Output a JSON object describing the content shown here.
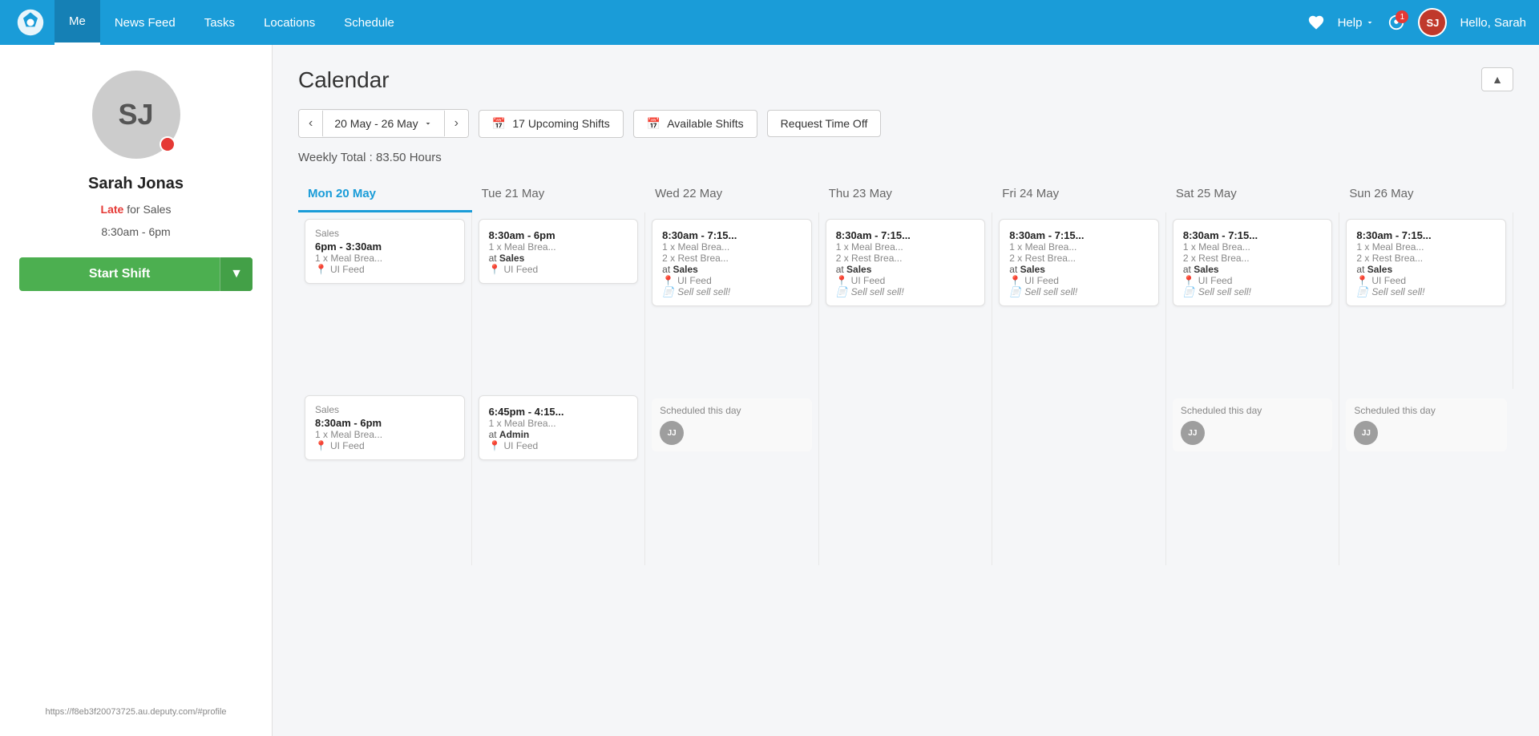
{
  "app": {
    "logo_alt": "Deputy Logo"
  },
  "topnav": {
    "links": [
      {
        "id": "me",
        "label": "Me",
        "active": true
      },
      {
        "id": "news-feed",
        "label": "News Feed",
        "active": false
      },
      {
        "id": "tasks",
        "label": "Tasks",
        "active": false
      },
      {
        "id": "locations",
        "label": "Locations",
        "active": false
      },
      {
        "id": "schedule",
        "label": "Schedule",
        "active": false
      }
    ],
    "help_label": "Help",
    "notification_count": "1",
    "user_initials": "SJ",
    "greeting": "Hello, Sarah"
  },
  "sidebar": {
    "avatar_initials": "SJ",
    "name": "Sarah Jonas",
    "status_prefix": "Late",
    "status_suffix": " for Sales",
    "time": "8:30am - 6pm",
    "start_shift_label": "Start Shift",
    "footer_url": "https://f8eb3f20073725.au.deputy.com/#profile"
  },
  "main": {
    "page_title": "Calendar",
    "week_range": "20 May - 26 May",
    "upcoming_shifts_label": "17 Upcoming Shifts",
    "available_shifts_label": "Available Shifts",
    "request_time_off_label": "Request Time Off",
    "weekly_total_label": "Weekly Total : 83.50 Hours",
    "collapse_icon": "▲",
    "days": [
      {
        "id": "mon",
        "label": "Mon 20 May",
        "today": true
      },
      {
        "id": "tue",
        "label": "Tue 21 May",
        "today": false
      },
      {
        "id": "wed",
        "label": "Wed 22 May",
        "today": false
      },
      {
        "id": "thu",
        "label": "Thu 23 May",
        "today": false
      },
      {
        "id": "fri",
        "label": "Fri 24 May",
        "today": false
      },
      {
        "id": "sat",
        "label": "Sat 25 May",
        "today": false
      },
      {
        "id": "sun",
        "label": "Sun 26 May",
        "today": false
      }
    ],
    "row1_shifts": [
      {
        "day": "mon",
        "role": "Sales",
        "time": "6pm - 3:30am",
        "break": "1 x Meal Brea...",
        "at": null,
        "location": "UI Feed",
        "notes": null
      },
      {
        "day": "tue",
        "role": null,
        "time": "8:30am - 6pm",
        "break": "1 x Meal Brea...",
        "at": "Sales",
        "location": "UI Feed",
        "notes": null
      },
      {
        "day": "wed",
        "role": null,
        "time": "8:30am - 7:15...",
        "break1": "1 x Meal Brea...",
        "break2": "2 x Rest Brea...",
        "at": "Sales",
        "location": "UI Feed",
        "notes": "Sell sell sell!"
      },
      {
        "day": "thu",
        "role": null,
        "time": "8:30am - 7:15...",
        "break1": "1 x Meal Brea...",
        "break2": "2 x Rest Brea...",
        "at": "Sales",
        "location": "UI Feed",
        "notes": "Sell sell sell!"
      },
      {
        "day": "fri",
        "role": null,
        "time": "8:30am - 7:15...",
        "break1": "1 x Meal Brea...",
        "break2": "2 x Rest Brea...",
        "at": "Sales",
        "location": "UI Feed",
        "notes": "Sell sell sell!"
      },
      {
        "day": "sat",
        "role": null,
        "time": "8:30am - 7:15...",
        "break1": "1 x Meal Brea...",
        "break2": "2 x Rest Brea...",
        "at": "Sales",
        "location": "UI Feed",
        "notes": "Sell sell sell!"
      },
      {
        "day": "sun",
        "role": null,
        "time": "8:30am - 7:15...",
        "break1": "1 x Meal Brea...",
        "break2": "2 x Rest Brea...",
        "at": "Sales",
        "location": "UI Feed",
        "notes": "Sell sell sell!"
      }
    ],
    "row2_shifts": [
      {
        "day": "mon",
        "role": "Sales",
        "time": "8:30am - 6pm",
        "break": "1 x Meal Brea...",
        "at": null,
        "location": "UI Feed",
        "notes": null,
        "scheduled": null
      },
      {
        "day": "tue",
        "role": null,
        "time": "6:45pm - 4:15...",
        "break": "1 x Meal Brea...",
        "at": "Admin",
        "location": "UI Feed",
        "notes": null,
        "scheduled": null
      },
      {
        "day": "wed",
        "role": null,
        "time": null,
        "break": null,
        "at": null,
        "location": null,
        "notes": null,
        "scheduled": "JJ"
      },
      {
        "day": "thu",
        "role": null,
        "time": null,
        "break": null,
        "at": null,
        "location": null,
        "notes": null,
        "scheduled": null
      },
      {
        "day": "fri",
        "role": null,
        "time": null,
        "break": null,
        "at": null,
        "location": null,
        "notes": null,
        "scheduled": null
      },
      {
        "day": "sat",
        "role": null,
        "time": null,
        "break": null,
        "at": null,
        "location": null,
        "notes": null,
        "scheduled": "JJ"
      },
      {
        "day": "sun",
        "role": null,
        "time": null,
        "break": null,
        "at": null,
        "location": null,
        "notes": null,
        "scheduled": "JJ"
      }
    ],
    "scheduled_this_day_label": "Scheduled this day"
  },
  "colors": {
    "brand": "#1a9cd8",
    "green": "#4caf50",
    "late": "#e53935",
    "text_dark": "#222",
    "text_medium": "#555",
    "text_light": "#888"
  }
}
